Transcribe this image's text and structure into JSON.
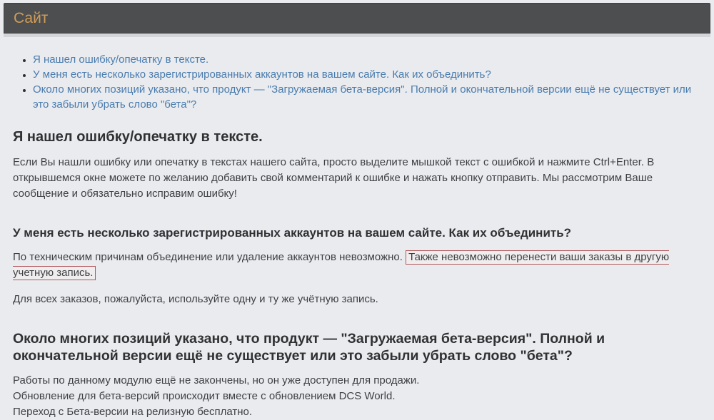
{
  "header": {
    "title": "Сайт"
  },
  "toc": {
    "items": [
      {
        "label": "Я нашел ошибку/опечатку в тексте."
      },
      {
        "label": "У меня есть несколько зарегистрированных аккаунтов на вашем сайте. Как их объединить?"
      },
      {
        "label": "Около многих позиций указано, что продукт — \"Загружаемая бета-версия\". Полной и окончательной версии ещё не существует или это забыли убрать слово \"бета\"?"
      }
    ]
  },
  "sections": [
    {
      "heading": "Я нашел ошибку/опечатку в тексте.",
      "body": "Если Вы нашли ошибку или опечатку в текстах нашего сайта, просто выделите мышкой текст с ошибкой и нажмите Ctrl+Enter. В открывшемся окне можете по желанию добавить свой комментарий к ошибке и нажать кнопку отправить. Мы рассмотрим Ваше сообщение и обязательно исправим ошибку!"
    },
    {
      "heading": "У меня есть несколько зарегистрированных аккаунтов на вашем сайте. Как их объединить?",
      "body": "По техническим причинам объединение или удаление аккаунтов невозможно.",
      "highlight": "Также невозможно перенести ваши заказы в другую учетную запись.",
      "body2": "Для всех заказов, пожалуйста, используйте одну и ту же учётную запись."
    },
    {
      "heading": "Около многих позиций указано, что продукт — \"Загружаемая бета-версия\". Полной и окончательной версии ещё не существует или это забыли убрать слово \"бета\"?",
      "lines": [
        "Работы по данному модулю ещё не закончены, но он уже доступен для продажи.",
        "Обновление для бета-версий происходит вместе с обновлением DCS World.",
        "Переход с Бета-версии на релизную бесплатно."
      ]
    }
  ],
  "colors": {
    "page_bg": "#e9ebee",
    "header_bg": "#4c4e50",
    "header_title": "#d09c58",
    "link": "#4a7cae",
    "heading": "#2f3133",
    "body_text": "#3e4043",
    "highlight_border": "#b05557"
  }
}
